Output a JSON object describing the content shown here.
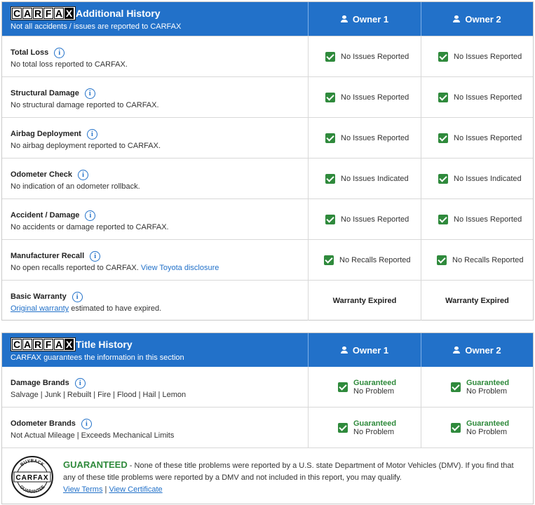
{
  "logo_text": "CARFAX",
  "additional_history": {
    "title": "Additional History",
    "subtitle": "Not all accidents / issues are reported to CARFAX",
    "owners": [
      "Owner 1",
      "Owner 2"
    ],
    "rows": [
      {
        "title": "Total Loss",
        "desc": "No total loss reported to CARFAX.",
        "owner1": "No Issues Reported",
        "owner2": "No Issues Reported"
      },
      {
        "title": "Structural Damage",
        "desc": "No structural damage reported to CARFAX.",
        "owner1": "No Issues Reported",
        "owner2": "No Issues Reported"
      },
      {
        "title": "Airbag Deployment",
        "desc": "No airbag deployment reported to CARFAX.",
        "owner1": "No Issues Reported",
        "owner2": "No Issues Reported"
      },
      {
        "title": "Odometer Check",
        "desc": "No indication of an odometer rollback.",
        "owner1": "No Issues Indicated",
        "owner2": "No Issues Indicated"
      },
      {
        "title": "Accident / Damage",
        "desc": "No accidents or damage reported to CARFAX.",
        "owner1": "No Issues Reported",
        "owner2": "No Issues Reported"
      },
      {
        "title": "Manufacturer Recall",
        "desc": "No open recalls reported to CARFAX.",
        "desc_link": "View Toyota disclosure",
        "owner1": "No Recalls Reported",
        "owner2": "No Recalls Reported"
      },
      {
        "title": "Basic Warranty",
        "desc_link": "Original warranty",
        "desc": "estimated to have expired.",
        "owner1": "Warranty Expired",
        "owner2": "Warranty Expired"
      }
    ]
  },
  "title_history": {
    "title": "Title History",
    "subtitle": "CARFAX guarantees the information in this section",
    "owners": [
      "Owner 1",
      "Owner 2"
    ],
    "rows": [
      {
        "title": "Damage Brands",
        "desc": "Salvage | Junk | Rebuilt | Fire | Flood | Hail | Lemon",
        "status_green": "Guaranteed",
        "status": "No Problem"
      },
      {
        "title": "Odometer Brands",
        "desc": "Not Actual Mileage | Exceeds Mechanical Limits",
        "status_green": "Guaranteed",
        "status": "No Problem"
      }
    ],
    "guarantee": {
      "heading": "GUARANTEED",
      "text": " - None of these title problems were reported by a U.S. state Department of Motor Vehicles (DMV). If you find that any of these title problems were reported by a DMV and not included in this report, you may qualify.",
      "view_terms": "View Terms",
      "separator": " | ",
      "view_certificate": "View Certificate",
      "seal_top": "BUYBACK",
      "seal_bottom": "GUARANTEE"
    }
  },
  "colors": {
    "header_blue": "#2271c9",
    "check_green": "#2f8a3c",
    "link_blue": "#2271c9"
  }
}
